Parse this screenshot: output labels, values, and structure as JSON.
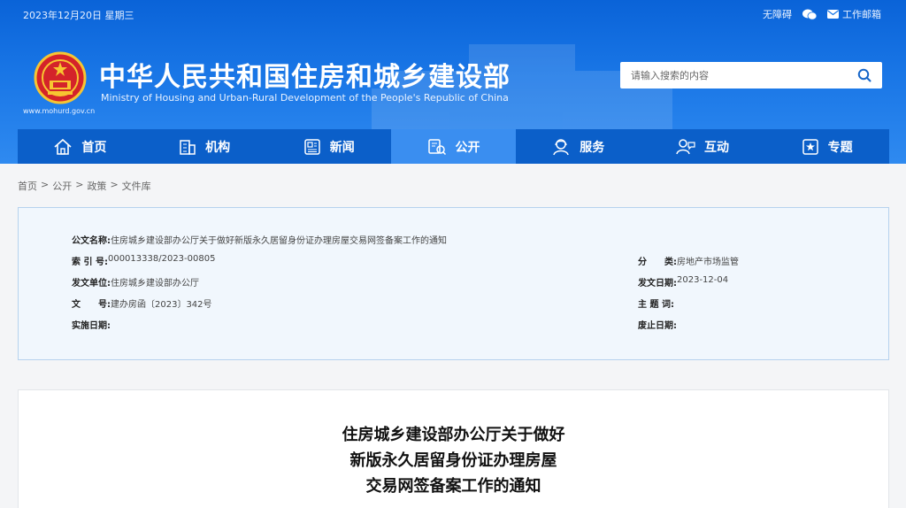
{
  "topbar": {
    "date": "2023年12月20日 星期三",
    "accessibility": "无障碍",
    "mail": "工作邮箱"
  },
  "site": {
    "title_cn": "中华人民共和国住房和城乡建设部",
    "title_en": "Ministry of Housing and Urban-Rural Development of the People's Republic of China",
    "url": "www.mohurd.gov.cn"
  },
  "search": {
    "placeholder": "请输入搜索的内容"
  },
  "nav": [
    {
      "label": "首页",
      "icon": "home-icon"
    },
    {
      "label": "机构",
      "icon": "building-icon"
    },
    {
      "label": "新闻",
      "icon": "news-icon"
    },
    {
      "label": "公开",
      "icon": "disclosure-icon"
    },
    {
      "label": "服务",
      "icon": "service-icon"
    },
    {
      "label": "互动",
      "icon": "interaction-icon"
    },
    {
      "label": "专题",
      "icon": "topic-icon"
    }
  ],
  "nav_active": "公开",
  "breadcrumb": [
    "首页",
    "公开",
    "政策",
    "文件库"
  ],
  "meta": {
    "doc_name_label": "公文名称:",
    "doc_name": "住房城乡建设部办公厅关于做好新版永久居留身份证办理房屋交易网签备案工作的通知",
    "index_label": "索 引 号:",
    "index": "000013338/2023-00805",
    "category_label": "分　　类:",
    "category": "房地产市场监管",
    "issuer_label": "发文单位:",
    "issuer": "住房城乡建设部办公厅",
    "issue_date_label": "发文日期:",
    "issue_date": "2023-12-04",
    "doc_no_label": "文　　号:",
    "doc_no": "建办房函〔2023〕342号",
    "subject_label": "主 题 词:",
    "subject": "",
    "effective_label": "实施日期:",
    "effective": "",
    "repeal_label": "废止日期:",
    "repeal": ""
  },
  "article": {
    "title_lines": [
      "住房城乡建设部办公厅关于做好",
      "新版永久居留身份证办理房屋",
      "交易网签备案工作的通知"
    ]
  },
  "colors": {
    "header": "#1976e6",
    "nav": "#0b5fc9",
    "nav_active": "#3a8ef0",
    "meta_bg": "#f1f7fd"
  }
}
